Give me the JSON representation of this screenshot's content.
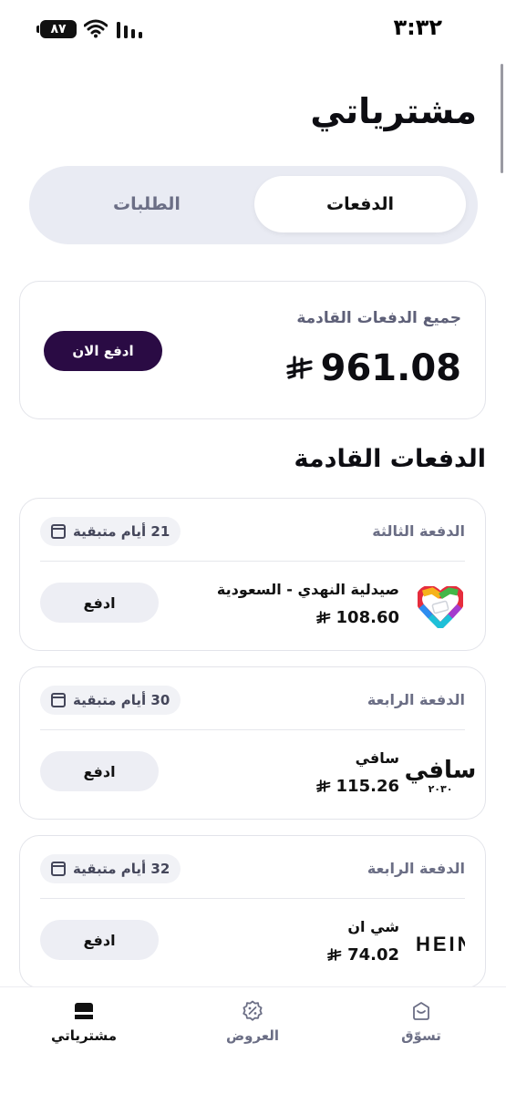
{
  "status_bar": {
    "time": "٣:٣٢",
    "battery": "٨٧"
  },
  "page": {
    "title": "مشترياتي"
  },
  "tabs": [
    {
      "label": "الدفعات",
      "active": true
    },
    {
      "label": "الطلبات",
      "active": false
    }
  ],
  "summary": {
    "label": "جميع الدفعات القادمة",
    "amount": "961.08",
    "pay_now_label": "ادفع الان"
  },
  "section": {
    "title": "الدفعات القادمة"
  },
  "payments": [
    {
      "installment": "الدفعة الثالثة",
      "days_left": "21 أيام متبقية",
      "merchant": "صيدلية النهدي - السعودية",
      "amount": "108.60",
      "pay_label": "ادفع",
      "logo": "nahdi-heart-logo"
    },
    {
      "installment": "الدفعة الرابعة",
      "days_left": "30 أيام متبقية",
      "merchant": "سافي",
      "amount": "115.26",
      "pay_label": "ادفع",
      "logo": "safi-logo",
      "logo_text": "سافي",
      "logo_sub": "٢٠٣٠"
    },
    {
      "installment": "الدفعة الرابعة",
      "days_left": "32 أيام متبقية",
      "merchant": "شي ان",
      "amount": "74.02",
      "pay_label": "ادفع",
      "logo": "shein-logo",
      "logo_text": "HEIN"
    }
  ],
  "bottom_nav": [
    {
      "label": "مشترياتي",
      "icon": "wallet-icon",
      "active": true
    },
    {
      "label": "العروض",
      "icon": "percent-badge-icon",
      "active": false
    },
    {
      "label": "تسوّق",
      "icon": "shop-bag-icon",
      "active": false
    }
  ],
  "colors": {
    "primary": "#2a0b44",
    "muted": "#6b6e85",
    "segment_bg": "#e9ebf3"
  }
}
